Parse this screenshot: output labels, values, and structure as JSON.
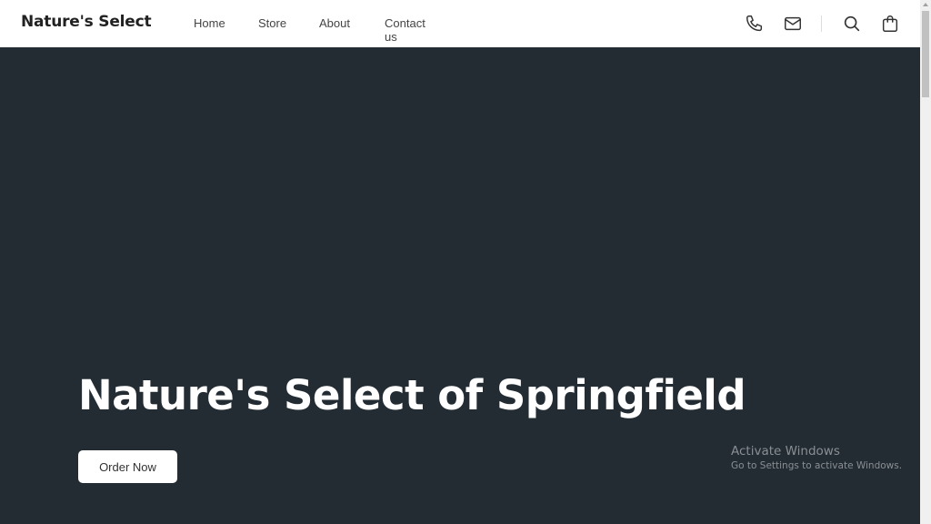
{
  "header": {
    "logo": "Nature's Select",
    "nav": [
      {
        "label": "Home"
      },
      {
        "label": "Store"
      },
      {
        "label": "About"
      },
      {
        "label": "Contact us"
      }
    ],
    "icons": [
      "phone-icon",
      "mail-icon",
      "search-icon",
      "shopping-bag-icon"
    ]
  },
  "hero": {
    "title": "Nature's Select of Springfield",
    "cta_label": "Order Now",
    "background_color": "#232c33"
  },
  "watermark": {
    "title": "Activate Windows",
    "subtitle": "Go to Settings to activate Windows."
  }
}
